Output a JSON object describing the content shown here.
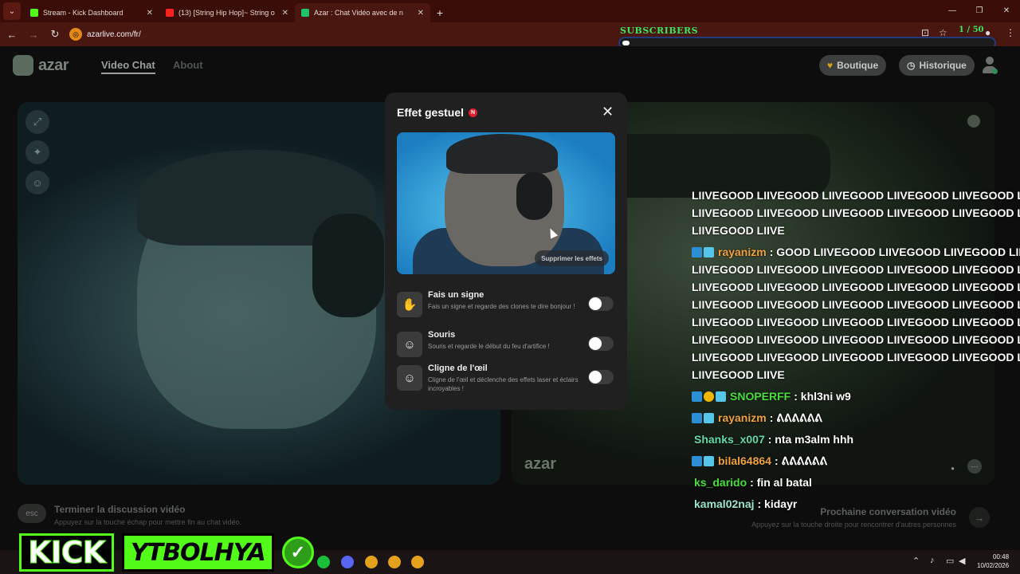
{
  "browser": {
    "tabs": [
      {
        "title": "Stream - Kick Dashboard",
        "fav_color": "#53fc18"
      },
      {
        "title": "(13) [String Hip Hop]~ String o",
        "fav_color": "#ff2020"
      },
      {
        "title": "Azar : Chat Vidéo avec de n",
        "fav_color": "#1fc36a"
      }
    ],
    "tab_close": "✕",
    "new_tab": "+",
    "url": "azarlive.com/fr/"
  },
  "overlay": {
    "subscribers_title": "SUBSCRIBERS",
    "subscribers_count": "1 / 50",
    "subscribers_progress": 0.02
  },
  "site": {
    "logo_text": "azar",
    "nav": {
      "video_chat": "Video Chat",
      "about": "About"
    },
    "boutique_label": "Boutique",
    "historique_label": "Historique",
    "watermark": "azar"
  },
  "modal": {
    "title": "Effet gestuel",
    "badge": "N",
    "close": "✕",
    "remove_effects": "Supprimer les effets",
    "options": [
      {
        "title": "Fais un signe",
        "desc": "Fais un signe et regarde des clones te dire bonjour !",
        "icon": "✋"
      },
      {
        "title": "Souris",
        "desc": "Souris et regarde le début du feu d'artifice !",
        "icon": "☺"
      },
      {
        "title": "Cligne de l'œil",
        "desc": "Cligne de l'œil et déclenche des effets laser et éclairs incroyables !",
        "icon": "☺"
      }
    ]
  },
  "footer": {
    "esc": "esc",
    "end_title": "Terminer la discussion vidéo",
    "end_sub": "Appuyez sur la touche échap pour mettre fin au chat vidéo.",
    "next_title": "Prochaine conversation vidéo",
    "next_sub": "Appuyez sur la touche droite pour rencontrer d'autres personnes",
    "next_arrow": "→"
  },
  "chat": {
    "intro_lines": [
      "LIIVEGOOD LIIVEGOOD LIIVEGOOD LIIVEGOOD LIIVEGOOD LIIV",
      "LIIVEGOOD LIIVEGOOD LIIVEGOOD LIIVEGOOD LIIVEGOOD LIIV",
      "LIIVEGOOD LIIVE"
    ],
    "messages": [
      {
        "user": "rayanizm",
        "color": "#f0a33a",
        "badges": [
          "b1",
          "b2"
        ],
        "text": ": GOOD LIIVEGOOD LIIVEGOOD LIIVEGOOD LIIV",
        "extra": [
          "LIIVEGOOD LIIVEGOOD LIIVEGOOD LIIVEGOOD LIIVEGOOD LIIV",
          "LIIVEGOOD LIIVEGOOD LIIVEGOOD LIIVEGOOD LIIVEGOOD LIIV",
          "LIIVEGOOD LIIVEGOOD LIIVEGOOD LIIVEGOOD LIIVEGOOD LIIV",
          "LIIVEGOOD LIIVEGOOD LIIVEGOOD LIIVEGOOD LIIVEGOOD LIIV",
          "LIIVEGOOD LIIVEGOOD LIIVEGOOD LIIVEGOOD LIIVEGOOD LIIV",
          "LIIVEGOOD LIIVEGOOD LIIVEGOOD LIIVEGOOD LIIVEGOOD LIIV",
          "LIIVEGOOD LIIVE"
        ]
      },
      {
        "user": "SNOPERFF",
        "color": "#4ade3b",
        "badges": [
          "b1",
          "b3",
          "b2"
        ],
        "text": ": khl3ni w9"
      },
      {
        "user": "rayanizm",
        "color": "#f0a33a",
        "badges": [
          "b1",
          "b2"
        ],
        "text": ": ᕕᕕᕕᕕᕕᕕ"
      },
      {
        "user": "Shanks_x007",
        "color": "#63d9a6",
        "badges": [],
        "text": ": nta m3alm hhh"
      },
      {
        "user": "bilal64864",
        "color": "#f0a33a",
        "badges": [
          "b1",
          "b2"
        ],
        "text": ": ᕕᕕᕕᕕᕕᕕ"
      },
      {
        "user": "ks_darido",
        "color": "#4ade3b",
        "badges": [],
        "text": ": fin al batal"
      },
      {
        "user": "kamal02naj",
        "color": "#9ce6c9",
        "badges": [],
        "text": ": kidayr"
      }
    ]
  },
  "banner": {
    "kick": "KICK",
    "channel": "YTBOLHYA",
    "check": "✓"
  },
  "taskbar": {
    "time": "00:48",
    "date": "10/02/2026"
  }
}
